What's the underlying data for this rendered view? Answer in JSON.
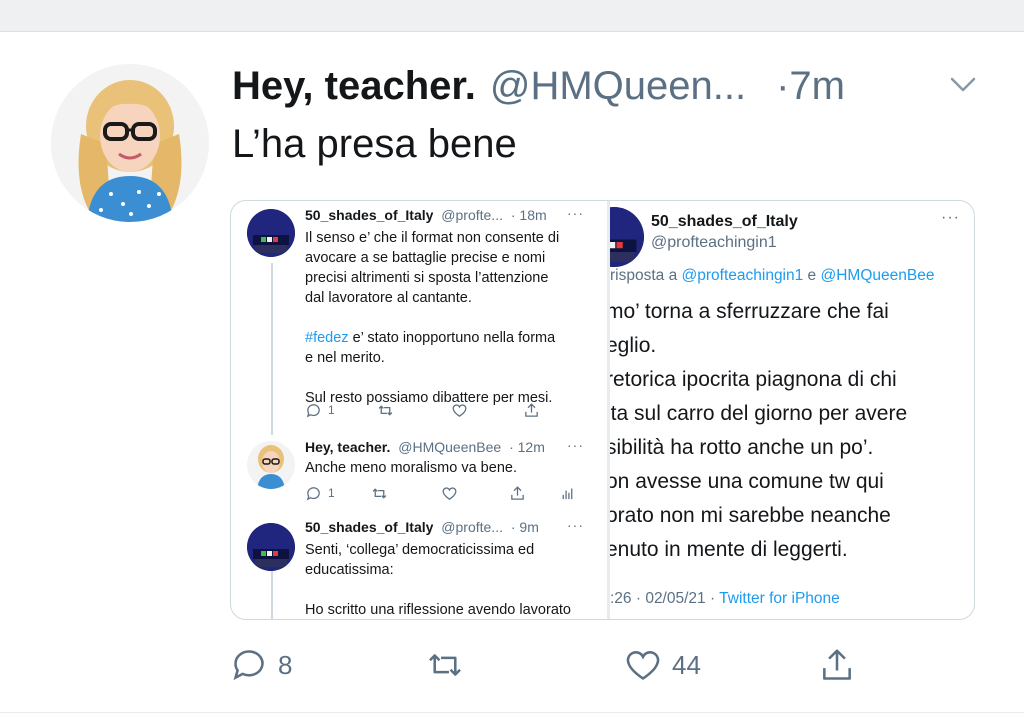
{
  "main_tweet": {
    "author_name": "Hey, teacher.",
    "author_handle": "@HMQueen...",
    "time": "·7m",
    "text": "L’ha presa bene",
    "actions": {
      "reply_count": "8",
      "retweet_count": "",
      "like_count": "44"
    }
  },
  "screenshot_left": {
    "tweets": [
      {
        "name": "50_shades_of_Italy",
        "handle": "@profte...",
        "time": "· 18m",
        "dots": "···",
        "lines": [
          "Il senso e’ che il format non consente di",
          "avocare a se battaglie precise e nomi",
          "precisi altrimenti si sposta l’attenzione",
          "dal lavoratore al cantante."
        ],
        "hashtag": "#fedez",
        "hashtag_rest": " e’ stato inopportuno nella forma",
        "line_after_tag": "e nel merito.",
        "last_line": "Sul resto possiamo dibattere per mesi.",
        "reply_count": "1"
      },
      {
        "name": "Hey, teacher.",
        "handle": "@HMQueenBee",
        "time": "· 12m",
        "dots": "···",
        "text": "Anche meno moralismo va bene.",
        "reply_count": "1"
      },
      {
        "name": "50_shades_of_Italy",
        "handle": "@profte...",
        "time": "· 9m",
        "dots": "···",
        "lines": [
          "Senti, ‘collega’ democraticissima ed",
          "educatissima:",
          "",
          "Ho scritto una riflessione avendo lavorato"
        ]
      }
    ]
  },
  "screenshot_right": {
    "name": "50_shades_of_Italy",
    "handle": "@profteachingin1",
    "dots": "···",
    "reply_prefix": "risposta a ",
    "mention1": "@profteachingin1",
    "reply_and": " e ",
    "mention2": "@HMQueenBee",
    "body_lines": [
      "mo’ torna a sferruzzare che fai",
      "eglio.",
      "retorica ipocrita piagnona di chi",
      "lta sul carro del giorno per avere",
      "sibilità ha rotto anche un po’.",
      "on avesse una comune tw qui",
      "orato non mi sarebbe neanche",
      "enuto in mente di leggerti."
    ],
    "footer_time": ":26 · 02/05/21 · ",
    "footer_source": "Twitter for iPhone"
  },
  "colors": {
    "link": "#1d9bf0",
    "secondary_text": "#5b7083",
    "primary_text": "#14171a"
  }
}
